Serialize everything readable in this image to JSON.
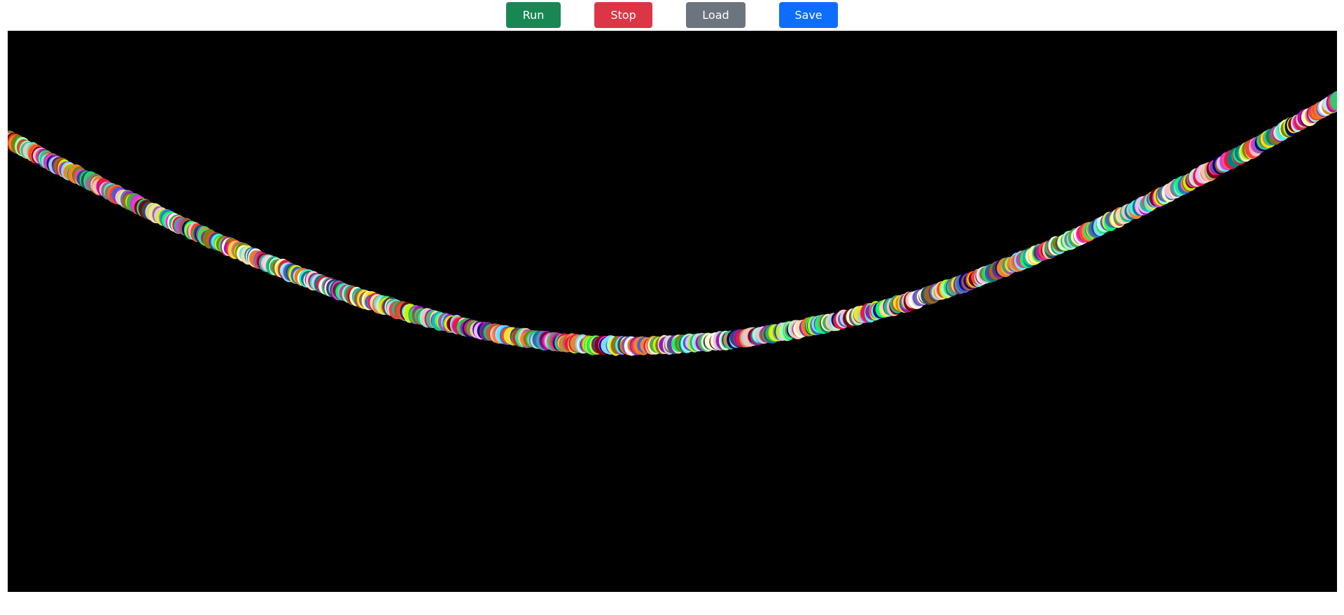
{
  "toolbar": {
    "run": {
      "label": "Run",
      "color": "#198754"
    },
    "stop": {
      "label": "Stop",
      "color": "#dc3545"
    },
    "load": {
      "label": "Load",
      "color": "#6c757d"
    },
    "save": {
      "label": "Save",
      "color": "#0d6efd"
    }
  },
  "canvas": {
    "background": "#000000",
    "dot_palette": [
      "#e6194b",
      "#3cb44b",
      "#ffe119",
      "#4363d8",
      "#f58231",
      "#911eb4",
      "#46f0f0",
      "#f032e6",
      "#bcf60c",
      "#fabebe",
      "#008080",
      "#e6beff",
      "#9a6324",
      "#fffac8",
      "#800000",
      "#aaffc3",
      "#808000",
      "#ffd8b1",
      "#000075",
      "#808080",
      "#ffffff",
      "#2ecc71",
      "#1abc9c",
      "#9b59b6",
      "#e67e22",
      "#34495e",
      "#7fdbff",
      "#ff4136",
      "#b10dc9",
      "#01ff70"
    ]
  }
}
